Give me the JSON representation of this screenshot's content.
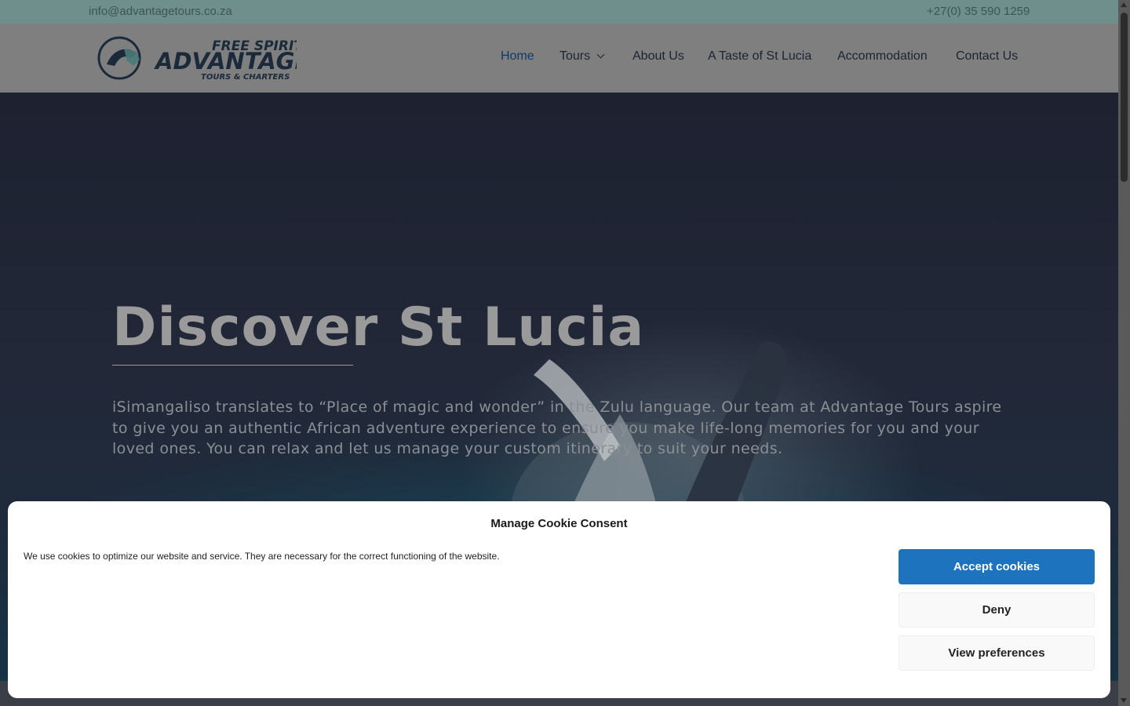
{
  "topbar": {
    "email": "info@advantagetours.co.za",
    "phone": "+27(0) 35 590 1259"
  },
  "logo": {
    "line1": "FREE SPIRIT",
    "line2": "ADVANTAGE",
    "line3": "TOURS & CHARTERS"
  },
  "nav": {
    "items": [
      {
        "label": "Home",
        "active": true
      },
      {
        "label": "Tours",
        "has_dropdown": true
      },
      {
        "label": "About Us"
      },
      {
        "label": "A Taste of St Lucia"
      },
      {
        "label": "Accommodation"
      },
      {
        "label": "Contact Us"
      }
    ]
  },
  "hero": {
    "title": "Discover St Lucia",
    "text": "iSimangaliso translates to “Place of magic and wonder” in the Zulu language. Our team at Advantage Tours aspire to give you an authentic African adventure experience to ensure you make life-long memories for you and your loved ones. You can relax and let us manage your custom itinerary to suit your needs."
  },
  "cookie": {
    "title": "Manage Cookie Consent",
    "text": "We use cookies to optimize our website and service. They are necessary for the correct functioning of the website.",
    "accept_label": "Accept cookies",
    "deny_label": "Deny",
    "prefs_label": "View preferences"
  },
  "colors": {
    "accent": "#1e73be",
    "topbar": "#6f8f8c",
    "nav_active": "#0b3a6a"
  }
}
